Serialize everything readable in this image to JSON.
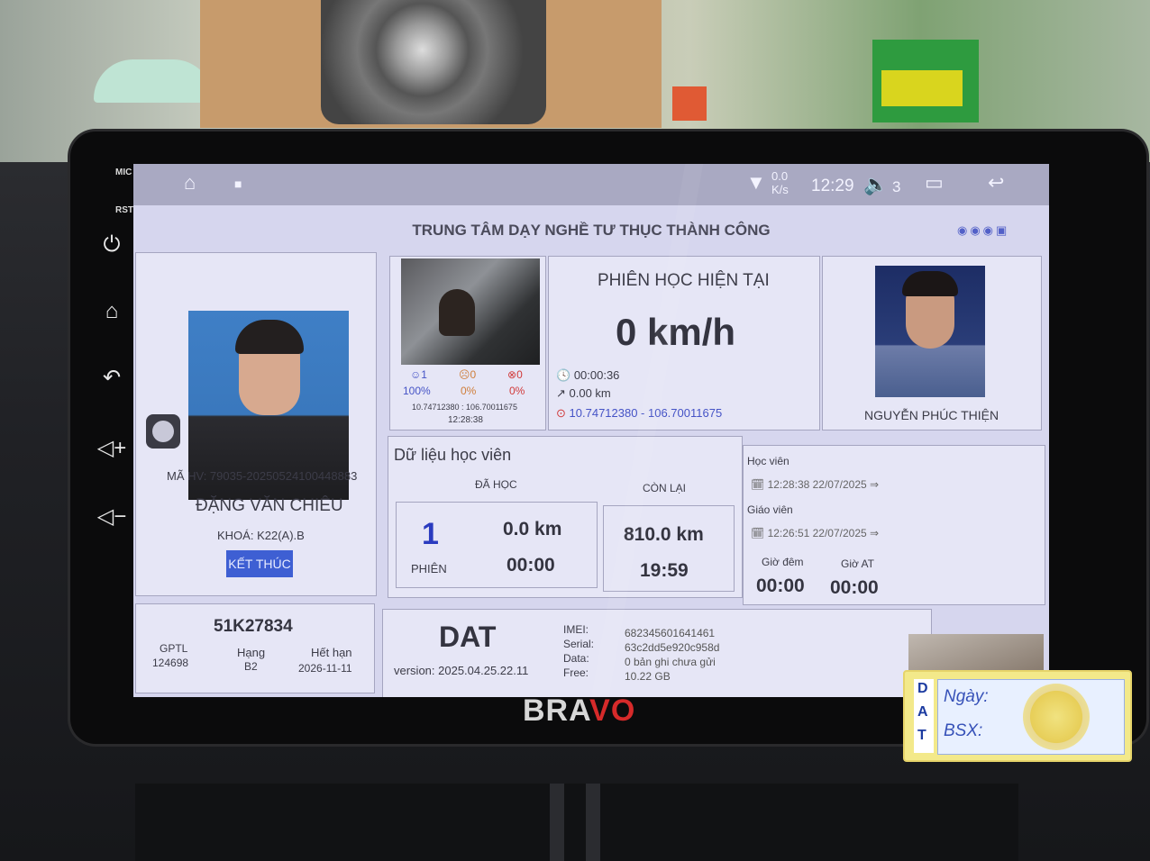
{
  "environment": {
    "camera_icon": "dashcam-icon",
    "sign_icon": "shop-sign"
  },
  "device": {
    "brand_prefix": "BRA",
    "brand_suffix": "VO",
    "side_labels": {
      "mic": "MIC",
      "rst": "RST"
    },
    "side_buttons": [
      "power-icon",
      "home-icon",
      "back-icon",
      "volume-up-icon",
      "volume-down-icon"
    ]
  },
  "status_bar": {
    "speed_top": "0.0",
    "speed_unit": "K/s",
    "time": "12:29",
    "volume": "3"
  },
  "app": {
    "center_name": "TRUNG TÂM DẠY NGHỀ TƯ THỤC THÀNH CÔNG",
    "student": {
      "ma_hv": "MÃ HV: 79035-20250524100448883",
      "name": "ĐẶNG VĂN CHIÊU",
      "khoa": "KHOÁ: K22(A).B",
      "end_button": "KẾT THÚC"
    },
    "camera": {
      "face_ok": "1",
      "face_warn": "0",
      "face_err": "0",
      "pct_ok": "100%",
      "pct_warn": "0%",
      "pct_err": "0%",
      "coords": "10.74712380 : 106.70011675",
      "time": "12:28:38"
    },
    "session": {
      "title": "PHIÊN HỌC HIỆN TẠI",
      "speed": "0 km/h",
      "duration": "00:00:36",
      "distance": "0.00 km",
      "coords": "10.74712380 - 106.70011675"
    },
    "teacher": {
      "name": "NGUYỄN PHÚC THIỆN"
    },
    "learner_data": {
      "title": "Dữ liệu học viên",
      "done_label": "ĐÃ HỌC",
      "remain_label": "CÒN LẠI",
      "sessions": "1",
      "sessions_label": "PHIÊN",
      "done_km": "0.0 km",
      "done_time": "00:00",
      "remain_km": "810.0 km",
      "remain_time": "19:59"
    },
    "login": {
      "student_label": "Học viên",
      "student_time": "12:28:38 22/07/2025",
      "teacher_label": "Giáo viên",
      "teacher_time": "12:26:51 22/07/2025",
      "night_label": "Giờ đêm",
      "at_label": "Giờ AT",
      "night_value": "00:00",
      "at_value": "00:00"
    },
    "vehicle": {
      "plate": "51K27834",
      "gptl_label": "GPTL",
      "gptl": "124698",
      "class_label": "Hạng",
      "class": "B2",
      "expiry_label": "Hết hạn",
      "expiry": "2026-11-11"
    },
    "device_info": {
      "name": "DAT",
      "version": "version: 2025.04.25.22.11",
      "imei_label": "IMEI:",
      "imei": "682345601641461",
      "serial_label": "Serial:",
      "serial": "63c2dd5e920c958d",
      "data_label": "Data:",
      "data": "0 bản ghi chưa gửi",
      "free_label": "Free:",
      "free": "10.22 GB"
    }
  },
  "sticker": {
    "letters": [
      "D",
      "A",
      "T"
    ],
    "date_label": "Ngày:",
    "plate_label": "BSX:"
  },
  "colors": {
    "accent": "#3e5fd3",
    "screen_bg": "#d6d6ee",
    "panel": "#e6e6f6",
    "red": "#d13a3a"
  }
}
